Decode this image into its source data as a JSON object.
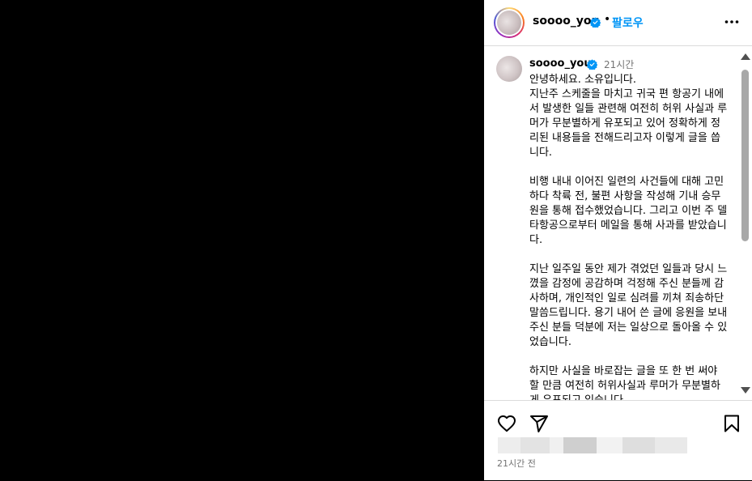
{
  "header": {
    "username": "soooo_you",
    "separator": "•",
    "follow_label": "팔로우"
  },
  "comment": {
    "username": "soooo_you",
    "time": "21시간",
    "text": "안녕하세요. 소유입니다.\n지난주 스케줄을 마치고 귀국 편 항공기 내에서 발생한 일들 관련해 여전히 허위 사실과 루머가 무분별하게 유포되고 있어 정확하게 정리된 내용들을 전해드리고자 이렇게 글을 씁니다.\n\n비행 내내 이어진 일련의 사건들에 대해 고민하다 착륙 전, 불편 사항을 작성해 기내 승무원을 통해 접수했었습니다. 그리고 이번 주 델타항공으로부터 메일을 통해 사과를 받았습니다.\n\n지난 일주일 동안 제가 겪었던 일들과 당시 느꼈을 감정에 공감하며 걱정해 주신 분들께 감사하며, 개인적인 일로 심려를 끼쳐 죄송하단 말씀드립니다. 용기 내어 쓴 글에 응원을 보내주신 분들 덕분에 저는 일상으로 돌아올 수 있었습니다.\n\n하지만 사실을 바로잡는 글을 또 한 번 써야 할 만큼 여전히 허위사실과 루머가 무분별하게 유포되고 있습니다."
  },
  "footer": {
    "timestamp": "21시간 전",
    "likes_blur_colors": [
      "#ededed",
      "#e3e3e3",
      "#f0f0f0",
      "#cfcfcf",
      "#f2f2f2",
      "#dedede",
      "#e9e9e9"
    ]
  },
  "colors": {
    "accent": "#0095f6",
    "verified": "#0095f6",
    "secondary_text": "#737373",
    "border": "#dbdbdb"
  },
  "icons": [
    "verified-badge-icon",
    "more-options-icon",
    "heart-icon",
    "share-icon",
    "bookmark-icon",
    "scroll-up-arrow-icon",
    "scroll-down-arrow-icon"
  ]
}
